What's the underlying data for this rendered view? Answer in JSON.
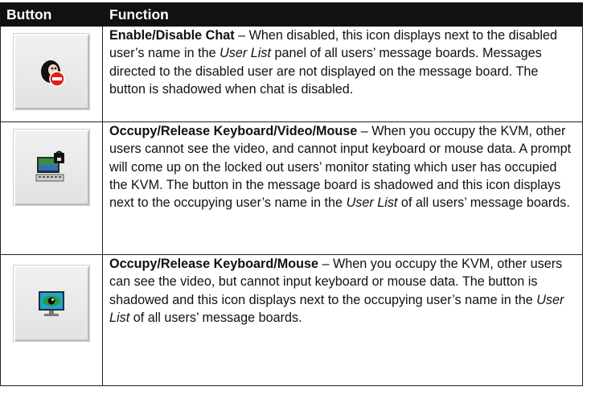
{
  "table": {
    "headers": [
      "Button",
      "Function"
    ],
    "rows": [
      {
        "icon": "user-chat-disabled-icon",
        "title": "Enable/Disable Chat",
        "dash": " – ",
        "p1": "When disabled, this icon displays next to the disabled user’s name in the ",
        "em1": "User List",
        "p2": " panel of all users’ message boards. Messages directed to the disabled user are not displayed on the message board. The button is shadowed when chat is disabled."
      },
      {
        "icon": "monitor-lock-keyboard-icon",
        "title": "Occupy/Release Keyboard/Video/Mouse",
        "dash": " – ",
        "p1": "When you occupy the KVM, other users cannot see the video, and cannot input keyboard or mouse data. A prompt will come up on the locked out users’ monitor stating which user has occupied the KVM. The button in the message board is shadowed and this icon displays next to the occupying user’s name in the ",
        "em1": "User List",
        "p2": " of all users’ message boards."
      },
      {
        "icon": "monitor-eye-icon",
        "title": "Occupy/Release Keyboard/Mouse",
        "dash": " – ",
        "p1": "When you occupy the KVM, other users can see the video, but cannot input keyboard or mouse data. The button is shadowed and this icon displays next to the occupying user’s name in the ",
        "em1": "User List",
        "p2": " of all users’ message boards."
      }
    ]
  }
}
